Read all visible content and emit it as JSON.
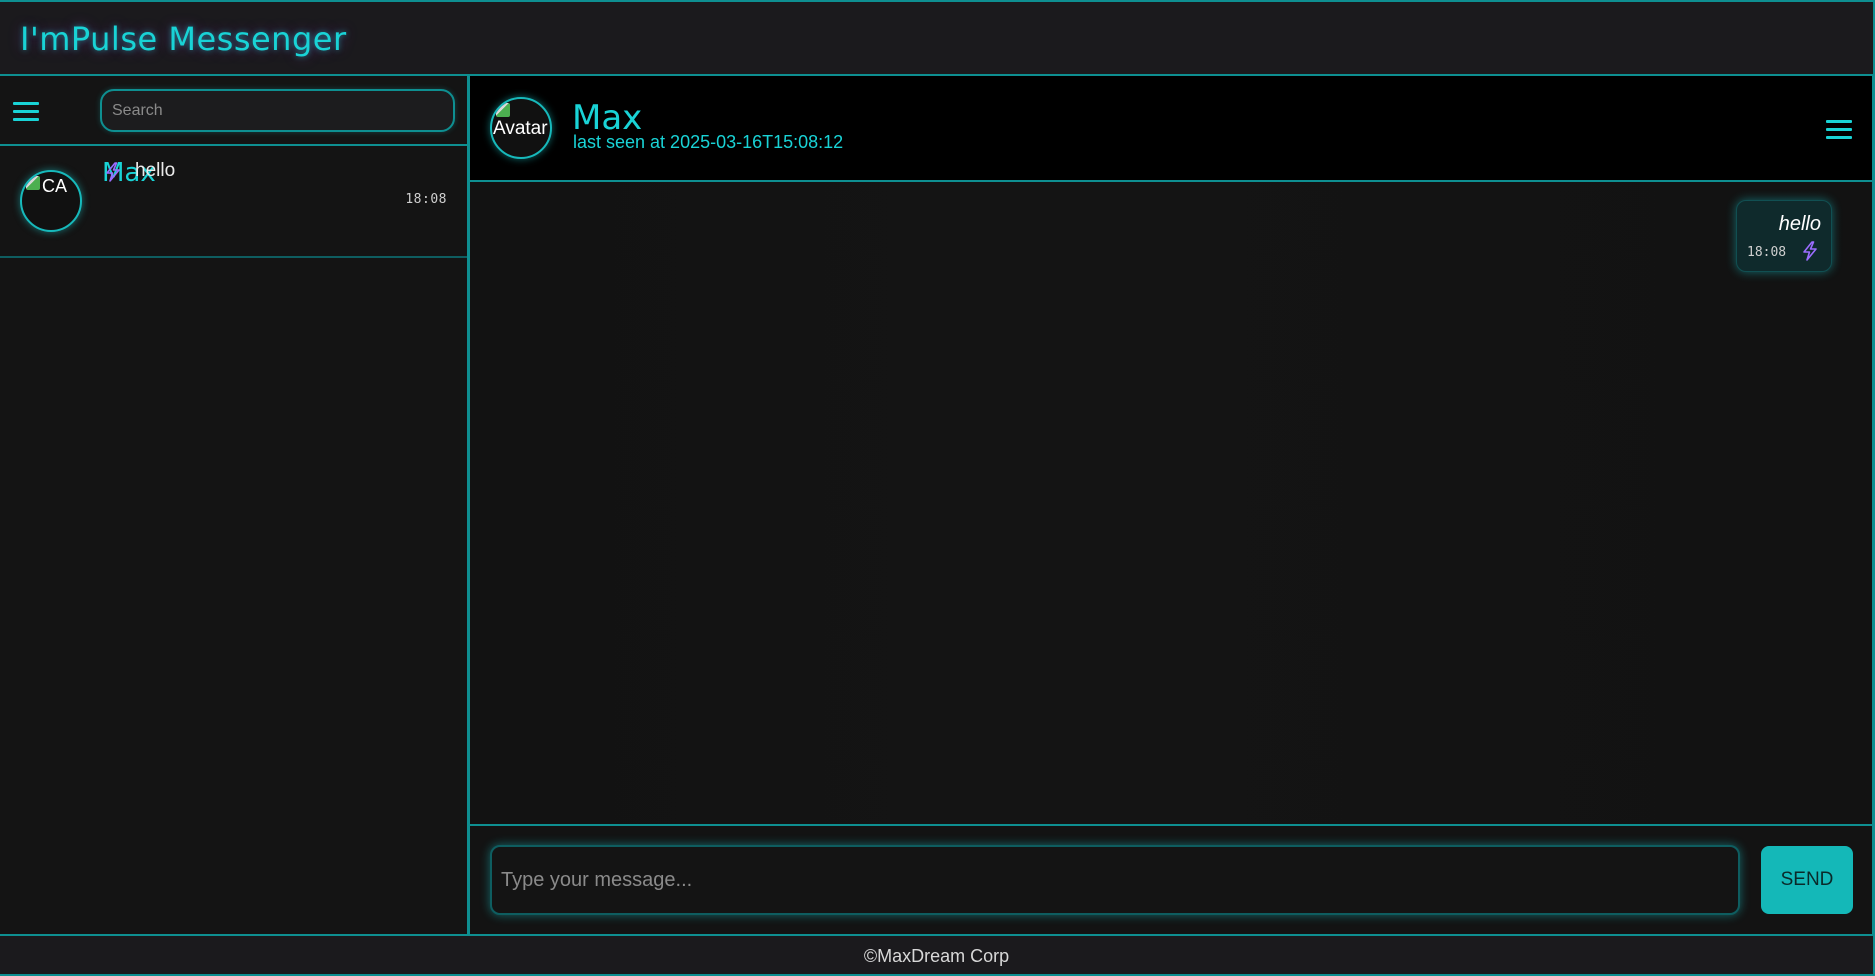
{
  "header": {
    "title": "I'mPulse Messenger"
  },
  "sidebar": {
    "menu_icon": "hamburger-menu-icon",
    "search": {
      "placeholder": "Search",
      "value": ""
    },
    "chats": [
      {
        "name": "Max",
        "avatar_alt": "CA",
        "last_message": "hello",
        "status_icon": "lightning-bolt-icon",
        "time": "18:08"
      }
    ]
  },
  "chat": {
    "contact": {
      "name": "Max",
      "avatar_alt": "Avatar",
      "status": "last seen at 2025-03-16T15:08:12"
    },
    "menu_icon": "hamburger-menu-icon",
    "messages": [
      {
        "text": "hello",
        "time": "18:08",
        "status_icon": "lightning-bolt-icon",
        "outgoing": true
      }
    ],
    "composer": {
      "placeholder": "Type your message...",
      "value": "",
      "send_label": "SEND"
    }
  },
  "footer": {
    "text": "©MaxDream Corp"
  },
  "colors": {
    "accent": "#19d3d6",
    "border": "#0e8f91",
    "send_button": "#14b8b8",
    "bolt": "#9b6cff",
    "background": "#141414"
  }
}
